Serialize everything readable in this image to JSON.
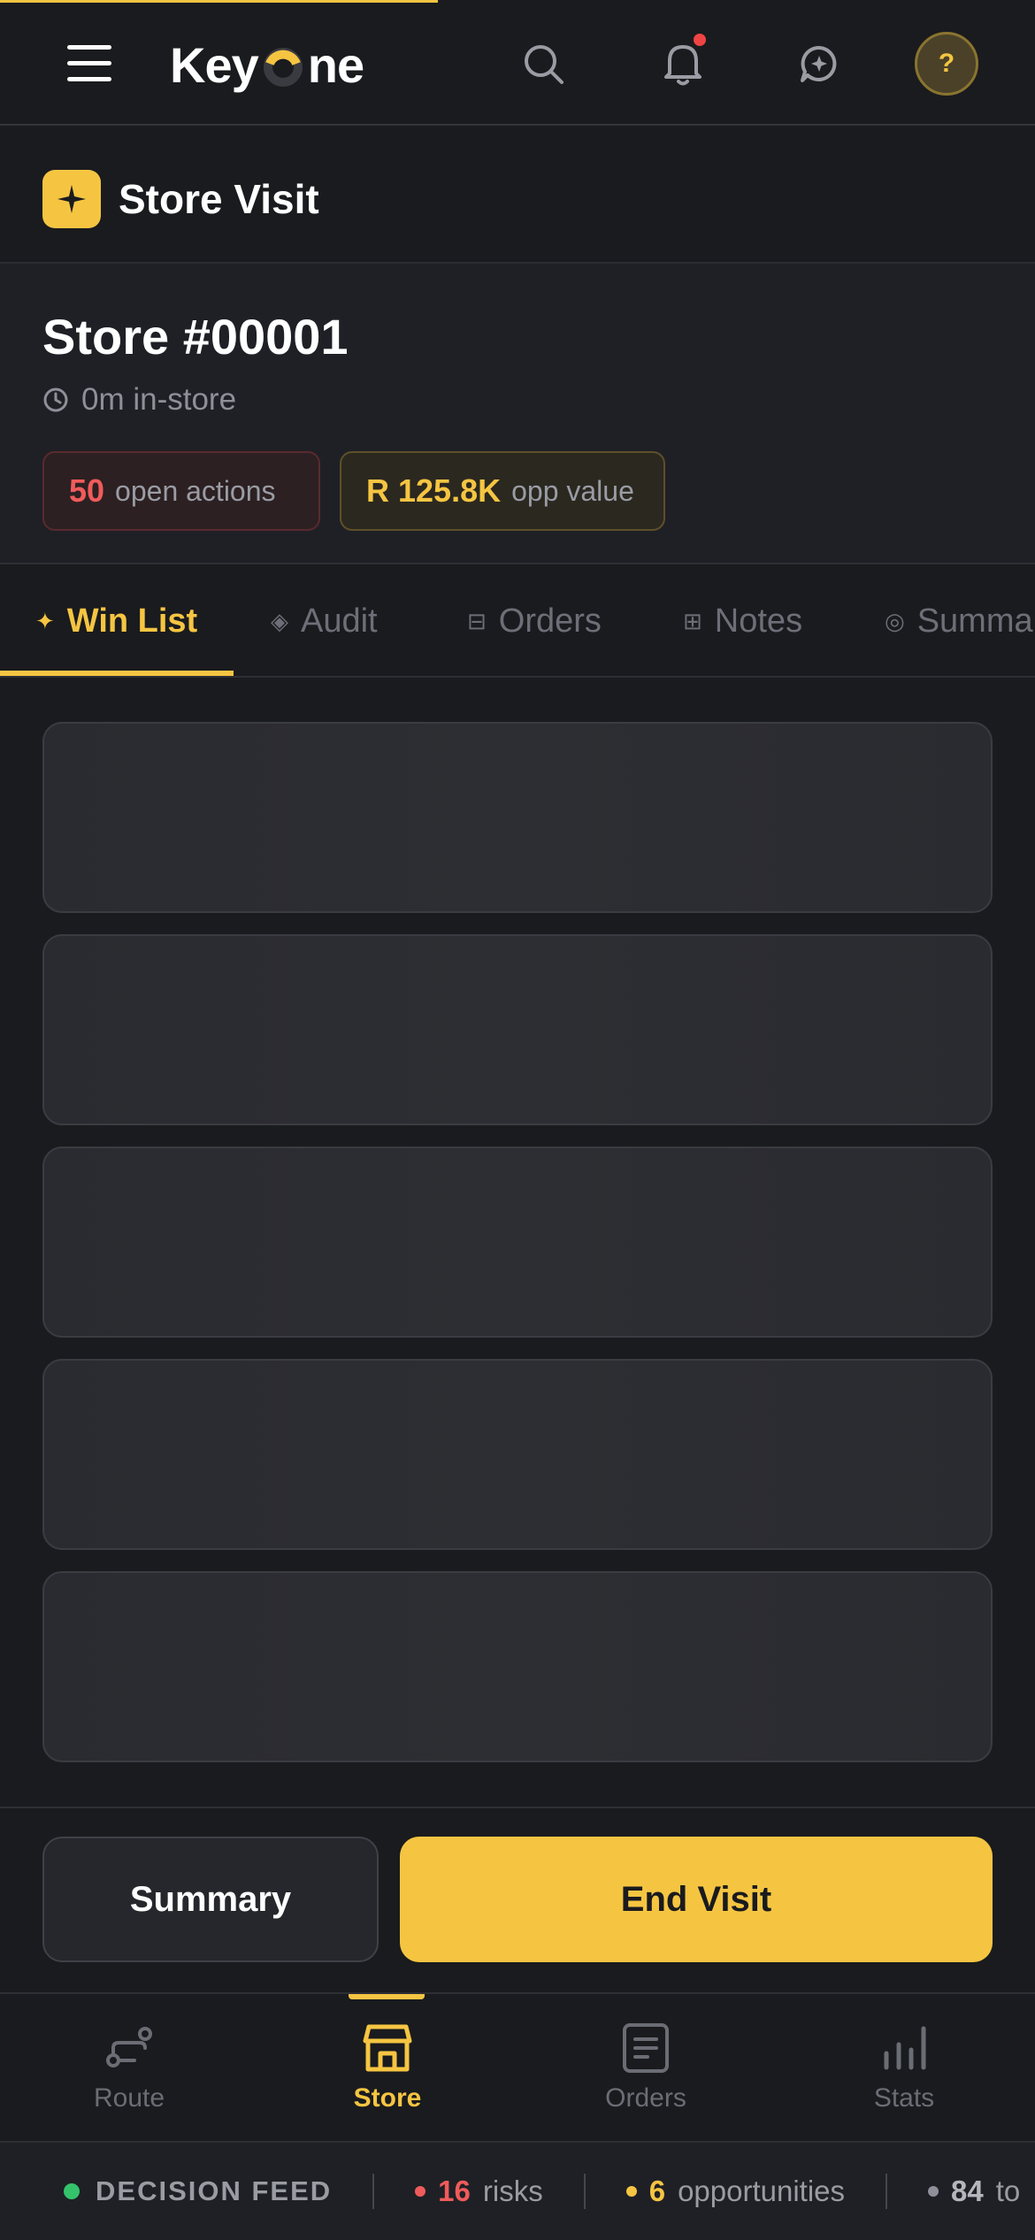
{
  "topbar": {
    "brand": {
      "prefix": "Key",
      "suffix": "ne"
    },
    "icons": [
      "menu-icon",
      "search-icon",
      "bell-icon",
      "ai-chat-icon"
    ],
    "help_label": "?"
  },
  "header": {
    "title": "Store Visit",
    "icon": "sparkle-icon"
  },
  "store": {
    "name": "Store #00001",
    "time_in_store": "0m in-store",
    "open_actions": {
      "count": "50",
      "label": "open actions"
    },
    "opp_value": {
      "amount": "R 125.8K",
      "label": "opp value"
    }
  },
  "tabs": [
    {
      "label": "Win List",
      "icon": "✦",
      "active": true
    },
    {
      "label": "Audit",
      "icon": "◈",
      "active": false
    },
    {
      "label": "Orders",
      "icon": "⊟",
      "active": false
    },
    {
      "label": "Notes",
      "icon": "⊞",
      "active": false
    },
    {
      "label": "Summary",
      "icon": "◎",
      "active": false
    }
  ],
  "actions": {
    "summary_label": "Summary",
    "end_visit_label": "End Visit"
  },
  "bottom_nav": [
    {
      "label": "Route",
      "icon": "route-icon",
      "active": false
    },
    {
      "label": "Store",
      "icon": "store-icon",
      "active": true
    },
    {
      "label": "Orders",
      "icon": "orders-icon",
      "active": false
    },
    {
      "label": "Stats",
      "icon": "stats-icon",
      "active": false
    }
  ],
  "feed": {
    "title": "DECISION FEED",
    "risks": {
      "count": "16",
      "label": "risks"
    },
    "opportunities": {
      "count": "6",
      "label": "opportunities"
    },
    "third": {
      "count": "84",
      "label": "to"
    }
  },
  "colors": {
    "accent": "#f5c542",
    "danger": "#ef5b5b",
    "live": "#34c36b",
    "background": "#1a1b1e"
  }
}
